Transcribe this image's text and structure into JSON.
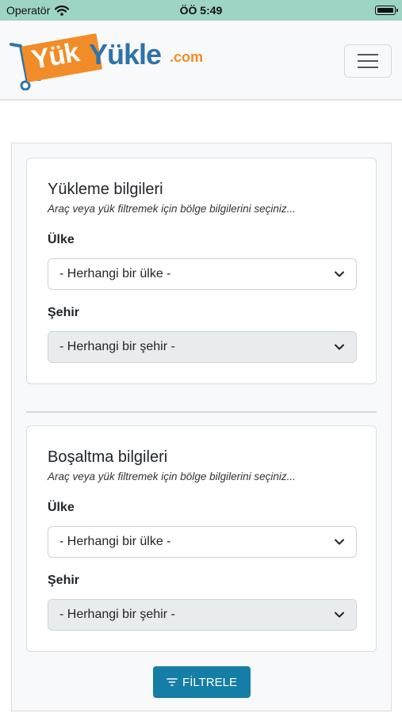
{
  "status_bar": {
    "carrier": "Operatör",
    "time": "ÖÖ 5:49"
  },
  "brand": {
    "part1": "Yük",
    "part2": "Yükle",
    "part3": ".com",
    "colors": {
      "orange": "#f28c28",
      "blue": "#2f73a8"
    }
  },
  "loading": {
    "title": "Yükleme bilgileri",
    "subtitle": "Araç veya yük filtremek için bölge bilgilerini seçiniz...",
    "country_label": "Ülke",
    "country_value": "- Herhangi bir ülke -",
    "city_label": "Şehir",
    "city_value": "- Herhangi bir şehir -"
  },
  "unloading": {
    "title": "Boşaltma bilgileri",
    "subtitle": "Araç veya yük filtremek için bölge bilgilerini seçiniz...",
    "country_label": "Ülke",
    "country_value": "- Herhangi bir ülke -",
    "city_label": "Şehir",
    "city_value": "- Herhangi bir şehir -"
  },
  "filter_button": {
    "label": "FİLTRELE",
    "color": "#157ea6"
  }
}
